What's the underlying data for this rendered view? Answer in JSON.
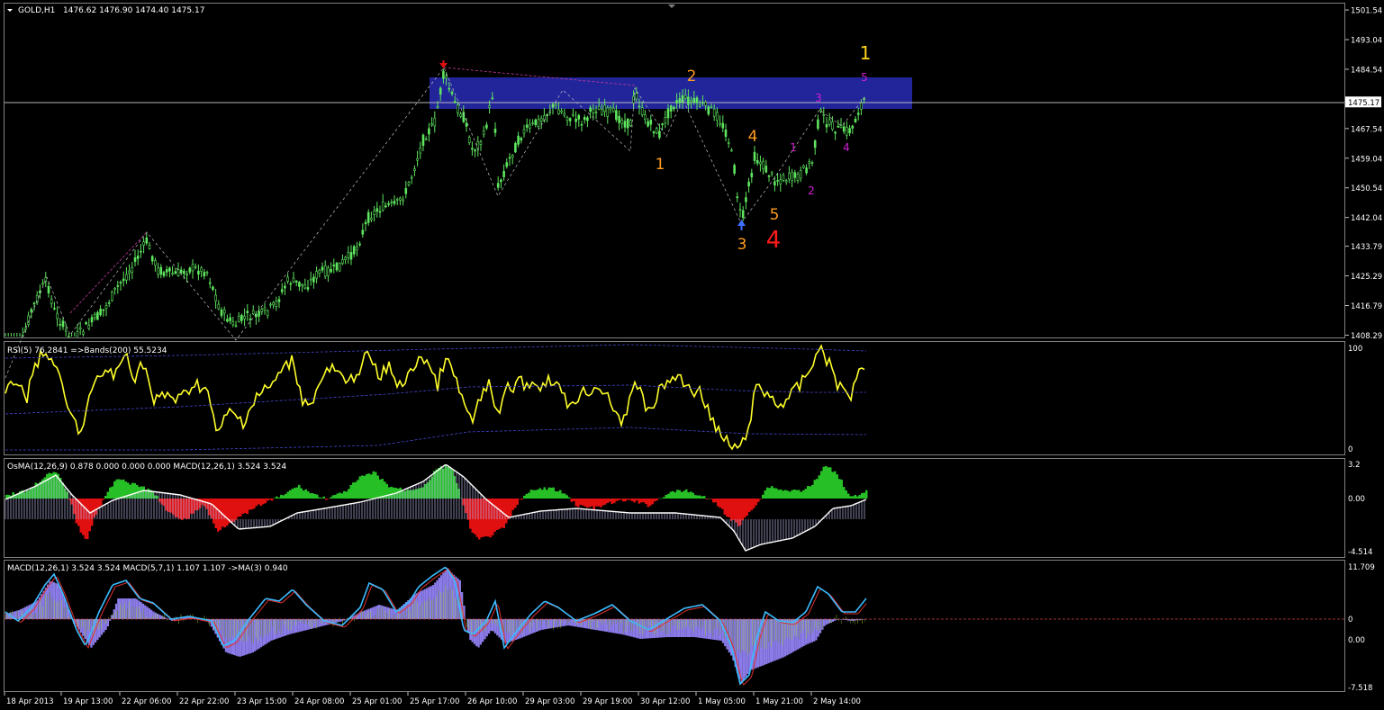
{
  "header": {
    "symbol": "GOLD,H1",
    "ohlc": "1476.62 1476.90 1474.40 1475.17"
  },
  "price_axis": {
    "ticks": [
      "1501.54",
      "1493.04",
      "1484.54",
      "1475.17",
      "1467.54",
      "1459.04",
      "1450.54",
      "1442.04",
      "1433.79",
      "1425.29",
      "1416.79",
      "1408.29"
    ],
    "current": "1475.17",
    "current_value": 1475.17,
    "range": [
      1407.5,
      1503.5
    ]
  },
  "wave_labels": [
    {
      "text": "1",
      "color": "#ffd21f",
      "big": false,
      "x_pos": "far right top"
    },
    {
      "text": "2",
      "color": "#ff9b1f"
    },
    {
      "text": "1",
      "color": "#ff9b1f"
    },
    {
      "text": "4",
      "color": "#ff9b1f"
    },
    {
      "text": "5",
      "color": "#ff9b1f"
    },
    {
      "text": "3",
      "color": "#ff9b1f"
    },
    {
      "text": "4",
      "color": "#ff1a1a"
    },
    {
      "text": "1",
      "color": "#d01fd0"
    },
    {
      "text": "2",
      "color": "#d01fd0"
    },
    {
      "text": "3",
      "color": "#d01fd0"
    },
    {
      "text": "4",
      "color": "#d01fd0"
    },
    {
      "text": "5",
      "color": "#d01fd0"
    }
  ],
  "rsi": {
    "label": "RSI(5) 76.2841  =>Bands(200) 55.5234",
    "ticks": [
      "100",
      "0"
    ]
  },
  "osma": {
    "label": "OsMA(12,26,9) 0.878 0.000 0.000 0.000  MACD(12,26,1) 3.524 3.524",
    "ticks": [
      "3.2",
      "0.00",
      "-4.514"
    ]
  },
  "macd": {
    "label": "MACD(12,26,1) 3.524 3.524  MACD(5,7,1) 1.107 1.107  ->MA(3) 0.940",
    "ticks": [
      "11.709",
      "0",
      "0.00",
      "-7.518"
    ]
  },
  "time_axis": {
    "ticks": [
      "18 Apr 2013",
      "19 Apr 13:00",
      "22 Apr 06:00",
      "22 Apr 22:00",
      "23 Apr 15:00",
      "24 Apr 08:00",
      "25 Apr 01:00",
      "25 Apr 17:00",
      "26 Apr 10:00",
      "29 Apr 03:00",
      "29 Apr 19:00",
      "30 Apr 12:00",
      "1 May 05:00",
      "1 May 21:00",
      "2 May 14:00"
    ]
  },
  "colors": {
    "candle": "#5ee65e",
    "zone": "#22259a",
    "rsi_line": "#ffff2a",
    "bands": "#4646d0",
    "osma_up": "#26c026",
    "osma_down": "#e01010",
    "macd_line": "#ffffff",
    "signal_line": "#3cbcff",
    "hist": "#8a7be8"
  }
}
